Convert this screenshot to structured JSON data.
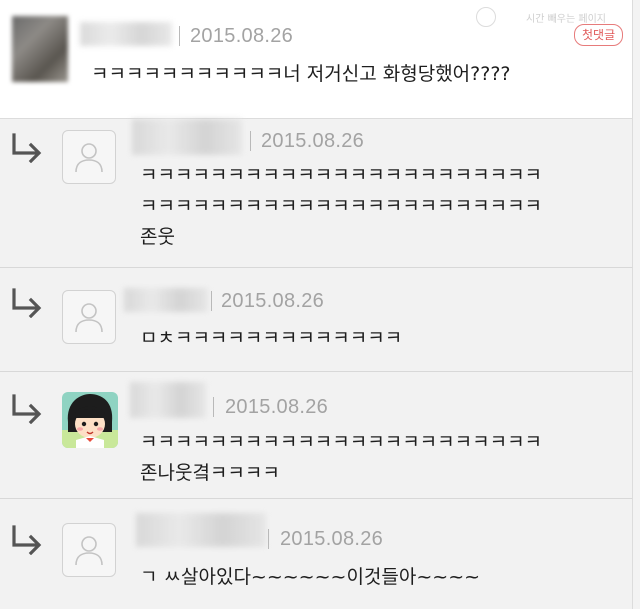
{
  "header": {
    "faint_label": "시간 빼우는 페이지",
    "badge_label": "첫댓글"
  },
  "comments": [
    {
      "date": "2015.08.26",
      "text_lines": [
        "ㅋㅋㅋㅋㅋㅋㅋㅋㅋㅋㅋ너 저거신고 화형당했어????"
      ]
    },
    {
      "date": "2015.08.26",
      "text_lines": [
        "ㅋㅋㅋㅋㅋㅋㅋㅋㅋㅋㅋㅋㅋㅋㅋㅋㅋㅋㅋㅋㅋㅋㅋ",
        "ㅋㅋㅋㅋㅋㅋㅋㅋㅋㅋㅋㅋㅋㅋㅋㅋㅋㅋㅋㅋㅋㅋㅋ",
        "존웃"
      ]
    },
    {
      "date": "2015.08.26",
      "text_lines": [
        "ㅁㅊㅋㅋㅋㅋㅋㅋㅋㅋㅋㅋㅋㅋㅋ"
      ]
    },
    {
      "date": "2015.08.26",
      "text_lines": [
        "ㅋㅋㅋㅋㅋㅋㅋㅋㅋㅋㅋㅋㅋㅋㅋㅋㅋㅋㅋㅋㅋㅋㅋ",
        "존나웃곀ㅋㅋㅋㅋ"
      ]
    },
    {
      "date": "2015.08.26",
      "text_lines": [
        "ㄱ ㅆ살아있다~~~~~~이것들아~~~~"
      ]
    }
  ],
  "icons": {
    "reply": "reply-arrow-icon",
    "default_avatar": "default-user-icon",
    "character_avatar": "character-avatar-icon"
  },
  "colors": {
    "date": "#a3a3a3",
    "badge": "#e05a5a",
    "reply_bg": "#f2f2f2",
    "top_bg": "#ffffff"
  }
}
